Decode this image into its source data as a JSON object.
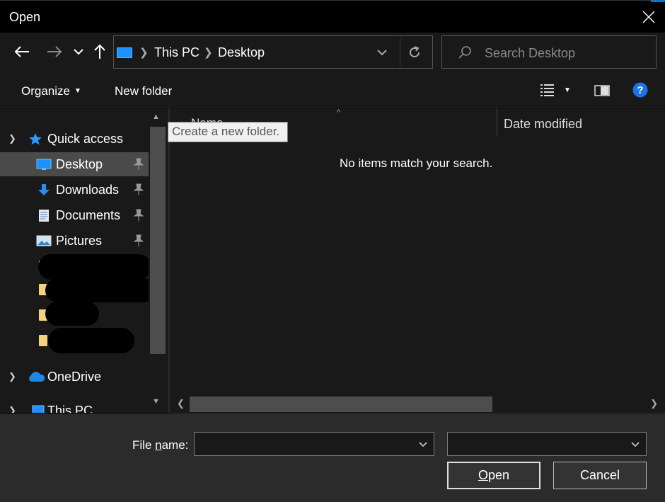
{
  "window": {
    "title": "Open"
  },
  "nav": {
    "back_icon": "arrow-left-icon",
    "forward_icon": "arrow-right-icon",
    "recent_icon": "chevron-down-icon",
    "up_icon": "arrow-up-icon"
  },
  "address": {
    "crumbs": [
      "This PC",
      "Desktop"
    ]
  },
  "search": {
    "placeholder": "Search Desktop"
  },
  "toolbar": {
    "organize": "Organize",
    "new_folder": "New folder"
  },
  "sidebar": {
    "quick_access": "Quick access",
    "items": [
      {
        "label": "Desktop",
        "icon": "desktop-icon",
        "pinned": true,
        "selected": true
      },
      {
        "label": "Downloads",
        "icon": "download-icon",
        "pinned": true
      },
      {
        "label": "Documents",
        "icon": "document-icon",
        "pinned": true
      },
      {
        "label": "Pictures",
        "icon": "pictures-icon",
        "pinned": true
      }
    ],
    "onedrive": "OneDrive",
    "this_pc": "This PC"
  },
  "content": {
    "col_name": "Name",
    "col_date": "Date modified",
    "empty_message": "No items match your search.",
    "tooltip": "Create a new folder."
  },
  "bottom": {
    "file_name_label_pre": "File ",
    "file_name_label_u": "n",
    "file_name_label_post": "ame:",
    "file_name_value": "",
    "open_pre": "",
    "open_u": "O",
    "open_post": "pen",
    "cancel": "Cancel"
  },
  "colors": {
    "accent": "#0078d4",
    "background": "#191919",
    "selected": "#4a4a4a"
  }
}
